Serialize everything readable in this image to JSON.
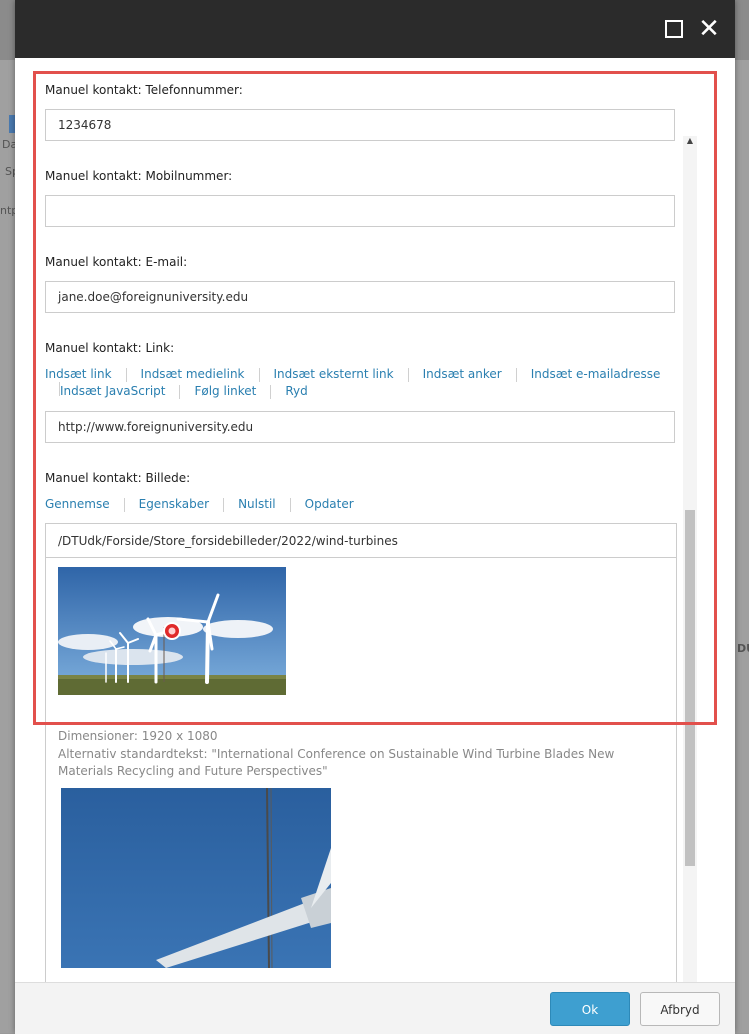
{
  "background": {
    "frag_da": "Da",
    "frag_sp": "Sp",
    "frag_ntp": "ntp",
    "frag_du": "DU"
  },
  "window": {
    "maximize_icon": "maximize-icon",
    "close_icon": "close-icon",
    "close_glyph": "✕"
  },
  "fields": {
    "phone": {
      "label": "Manuel kontakt: Telefonnummer:",
      "value": "1234678"
    },
    "mobile": {
      "label": "Manuel kontakt: Mobilnummer:",
      "value": ""
    },
    "email": {
      "label": "Manuel kontakt: E-mail:",
      "value": "jane.doe@foreignuniversity.edu"
    },
    "link": {
      "label": "Manuel kontakt: Link:",
      "actions": [
        "Indsæt link",
        "Indsæt medielink",
        "Indsæt eksternt link",
        "Indsæt anker",
        "Indsæt e-mailadresse",
        "Indsæt JavaScript",
        "Følg linket",
        "Ryd"
      ],
      "value": "http://www.foreignuniversity.edu"
    },
    "image": {
      "label": "Manuel kontakt: Billede:",
      "actions": [
        "Gennemse",
        "Egenskaber",
        "Nulstil",
        "Opdater"
      ],
      "path": "/DTUdk/Forside/Store_forsidebilleder/2022/wind-turbines",
      "dimensions": "Dimensioner: 1920 x 1080",
      "alt_text": "Alternativ standardtekst: \"International Conference on Sustainable Wind Turbine Blades New Materials Recycling and Future Perspectives\""
    }
  },
  "footer": {
    "ok_label": "Ok",
    "cancel_label": "Afbryd"
  },
  "colors": {
    "accent": "#3e9fd0",
    "link": "#2a7fb0",
    "highlight": "#e2504c",
    "titlebar": "#2b2b2b"
  }
}
